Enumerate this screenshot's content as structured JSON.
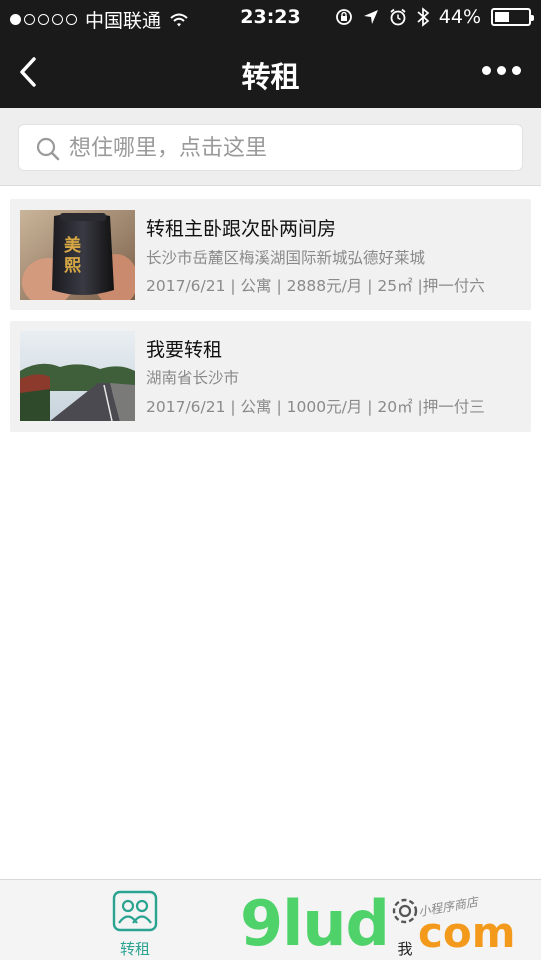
{
  "status_bar": {
    "carrier": "中国联通",
    "time": "23:23",
    "battery": "44%",
    "battery_level": 0.44
  },
  "nav": {
    "title": "转租"
  },
  "search": {
    "placeholder": "想住哪里，点击这里"
  },
  "listings": [
    {
      "title": "转租主卧跟次卧两间房",
      "address": "长沙市岳麓区梅溪湖国际新城弘德好莱城",
      "meta": "2017/6/21 | 公寓 | 2888元/月 | 25㎡ |押一付六",
      "thumb_text": "美熙"
    },
    {
      "title": "我要转租",
      "address": "湖南省长沙市",
      "meta": "2017/6/21 | 公寓 | 1000元/月 | 20㎡ |押一付三"
    }
  ],
  "tabs": {
    "rent_label": "转租",
    "me_label": "我"
  },
  "watermark": {
    "main": "9lud",
    "suffix": "com",
    "small": "小程序商店"
  },
  "colors": {
    "accent": "#2ba391",
    "nav_background": "#1a1a1a"
  }
}
